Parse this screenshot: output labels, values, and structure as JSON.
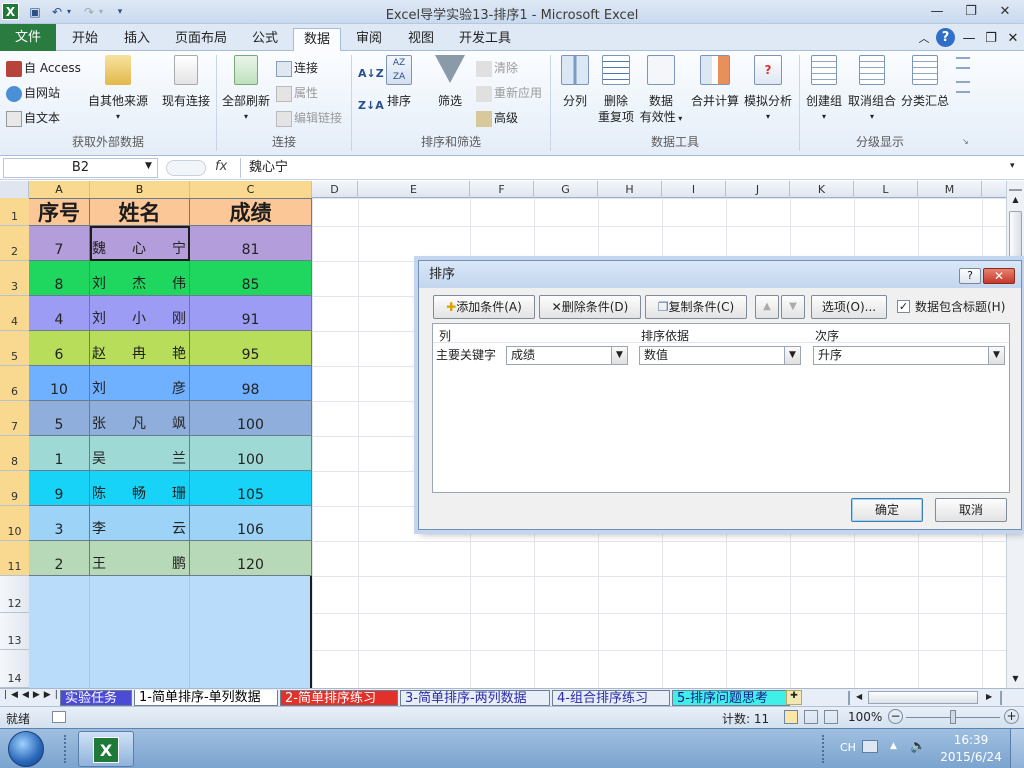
{
  "window": {
    "title": "Excel导学实验13-排序1  -  Microsoft Excel",
    "app_icon": "X"
  },
  "ribbon_tabs": [
    "开始",
    "插入",
    "页面布局",
    "公式",
    "数据",
    "审阅",
    "视图",
    "开发工具"
  ],
  "file_tab": "文件",
  "ribbon": {
    "get_external": {
      "label": "获取外部数据",
      "access": "自 Access",
      "web": "自网站",
      "text": "自文本",
      "other_sources": "自其他来源",
      "existing": "现有连接"
    },
    "connections": {
      "label": "连接",
      "refresh_all": "全部刷新",
      "connections": "连接",
      "properties": "属性",
      "edit_links": "编辑链接"
    },
    "sort_filter": {
      "label": "排序和筛选",
      "sort": "排序",
      "filter": "筛选",
      "clear": "清除",
      "reapply": "重新应用",
      "advanced": "高级"
    },
    "data_tools": {
      "label": "数据工具",
      "text_to_columns": "分列",
      "remove_dup_line1": "删除",
      "remove_dup_line2": "重复项",
      "validation_line1": "数据",
      "validation_line2": "有效性",
      "consolidate": "合并计算",
      "what_if": "模拟分析"
    },
    "outline": {
      "label": "分级显示",
      "group": "创建组",
      "ungroup": "取消组合",
      "subtotal": "分类汇总"
    }
  },
  "formula_bar": {
    "name_box": "B2",
    "fx": "fx",
    "content": "魏心宁"
  },
  "columns": [
    "A",
    "B",
    "C",
    "D",
    "E",
    "F",
    "G",
    "H",
    "I",
    "J",
    "K",
    "L",
    "M"
  ],
  "rows": [
    "1",
    "2",
    "3",
    "4",
    "5",
    "6",
    "7",
    "8",
    "9",
    "10",
    "11",
    "12",
    "13",
    "14"
  ],
  "table": {
    "headers": [
      "序号",
      "姓名",
      "成绩"
    ],
    "records": [
      {
        "id": "7",
        "name": [
          "魏",
          "心",
          "宁"
        ],
        "score": "81",
        "color": "#b39ddb"
      },
      {
        "id": "8",
        "name": [
          "刘",
          "杰",
          "伟"
        ],
        "score": "85",
        "color": "#1fd65f"
      },
      {
        "id": "4",
        "name": [
          "刘",
          "小",
          "刚"
        ],
        "score": "91",
        "color": "#9c9cf5"
      },
      {
        "id": "6",
        "name": [
          "赵",
          "冉",
          "艳"
        ],
        "score": "95",
        "color": "#b7dd5a"
      },
      {
        "id": "10",
        "name": [
          "刘",
          "",
          "彦"
        ],
        "score": "98",
        "color": "#6fb1ff"
      },
      {
        "id": "5",
        "name": [
          "张",
          "凡",
          "飒"
        ],
        "score": "100",
        "color": "#8faedb"
      },
      {
        "id": "1",
        "name": [
          "吴",
          "",
          "兰"
        ],
        "score": "100",
        "color": "#9fd9d5"
      },
      {
        "id": "9",
        "name": [
          "陈",
          "畅",
          "珊"
        ],
        "score": "105",
        "color": "#17d3f7"
      },
      {
        "id": "3",
        "name": [
          "李",
          "",
          "云"
        ],
        "score": "106",
        "color": "#9dd3f7"
      },
      {
        "id": "2",
        "name": [
          "王",
          "",
          "鹏"
        ],
        "score": "120",
        "color": "#b8d9b8"
      }
    ],
    "header_color": "#fbc797",
    "empty_color": "#b9dcfb"
  },
  "sheet_tabs": [
    {
      "label": "实验任务",
      "bg": "#4b4bd6",
      "fg": "#ffffff"
    },
    {
      "label": "1-简单排序-单列数据",
      "bg": "#ffffff",
      "fg": "#000000"
    },
    {
      "label": "2-简单排序练习",
      "bg": "#e0322b",
      "fg": "#ffffff"
    },
    {
      "label": "3-简单排序-两列数据",
      "bg": "#e7eef7",
      "fg": "#2a2aa8"
    },
    {
      "label": "4-组合排序练习",
      "bg": "#e7eef7",
      "fg": "#2a2aa8"
    },
    {
      "label": "5-排序问题思考",
      "bg": "#3ff0e8",
      "fg": "#1a1a8a"
    }
  ],
  "status": {
    "mode": "就绪",
    "count": "计数: 11",
    "zoom": "100%"
  },
  "taskbar": {
    "lang": "CH",
    "time": "16:39",
    "date": "2015/6/24"
  },
  "sort_dialog": {
    "title": "排序",
    "add_level": "添加条件(A)",
    "delete_level": "删除条件(D)",
    "copy_level": "复制条件(C)",
    "options": "选项(O)...",
    "has_headers": "数据包含标题(H)",
    "has_headers_checked": true,
    "col_header": "列",
    "sort_on_header": "排序依据",
    "order_header": "次序",
    "row_label": "主要关键字",
    "column_value": "成绩",
    "sort_on_value": "数值",
    "order_value": "升序",
    "ok": "确定",
    "cancel": "取消"
  }
}
